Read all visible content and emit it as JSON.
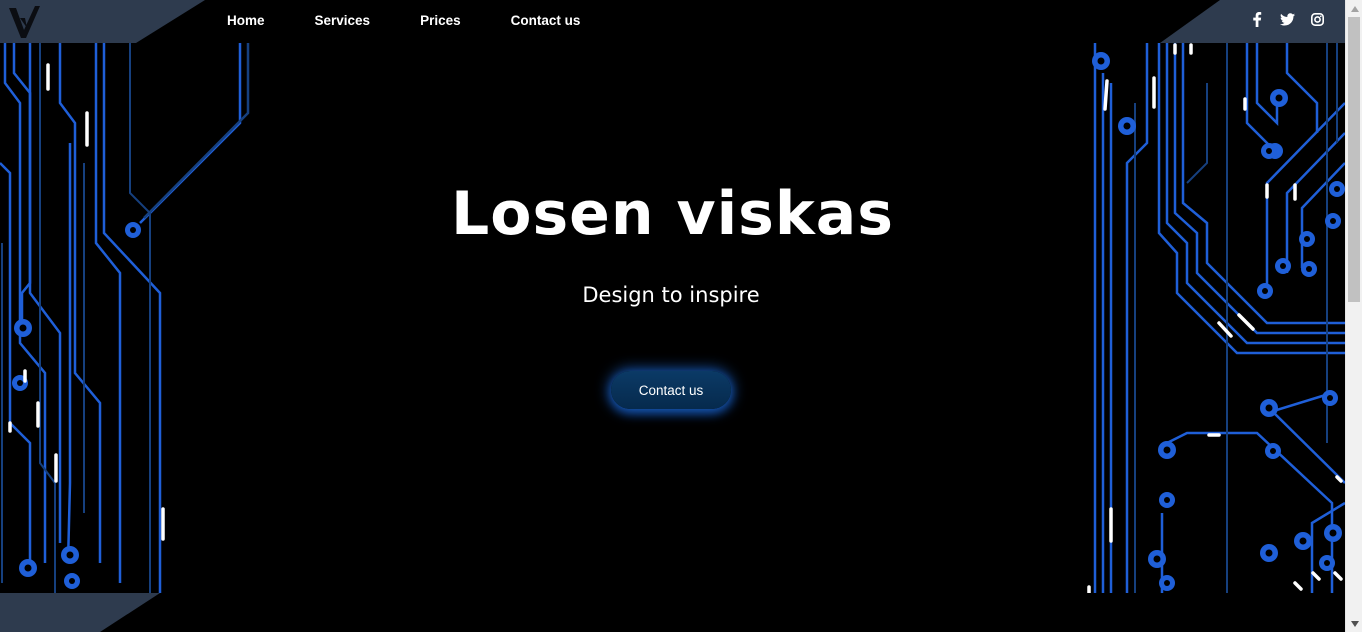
{
  "brand": {
    "logo_icon": "v-logo-icon",
    "plate_color": "#2e3b4e"
  },
  "nav": {
    "items": [
      {
        "label": "Home"
      },
      {
        "label": "Services"
      },
      {
        "label": "Prices"
      },
      {
        "label": "Contact us"
      }
    ]
  },
  "social": {
    "items": [
      {
        "icon": "facebook-icon"
      },
      {
        "icon": "twitter-icon"
      },
      {
        "icon": "instagram-icon"
      }
    ]
  },
  "hero": {
    "title": "Losen viskas",
    "subtitle": "Design to inspire",
    "cta_label": "Contact us"
  },
  "colors": {
    "background": "#000000",
    "circuit_trace": "#1f5fd8",
    "circuit_dark": "#0e2a55",
    "accent_glow": "#1e6edc"
  }
}
